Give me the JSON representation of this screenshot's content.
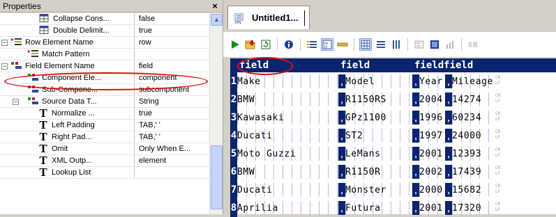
{
  "properties": {
    "title": "Properties",
    "close": "×",
    "rows": [
      {
        "label": "Collapse Cons...",
        "value": "false",
        "icon": "table-icon",
        "level": 2
      },
      {
        "label": "Double Delimit...",
        "value": "true",
        "icon": "table-icon",
        "level": 2
      },
      {
        "label": "Row Element Name",
        "value": "row",
        "icon": "list-element-icon",
        "level": 0
      },
      {
        "label": "Match Pattern",
        "value": "",
        "icon": "list-element-icon",
        "level": 1
      },
      {
        "label": "Field Element Name",
        "value": "field",
        "icon": "element-node-icon",
        "level": 0
      },
      {
        "label": "Component Ele...",
        "value": "component",
        "icon": "element-node-icon",
        "level": 1
      },
      {
        "label": "Sub-Compone...",
        "value": "subcomponent",
        "icon": "element-node-icon",
        "level": 1
      },
      {
        "label": "Source Data T...",
        "value": "String",
        "icon": "element-node-icon",
        "level": 1
      },
      {
        "label": "Normalize ...",
        "value": "true",
        "icon": "text-t-icon",
        "level": 2
      },
      {
        "label": "Left Padding",
        "value": "TAB,' '",
        "icon": "text-t-icon",
        "level": 2
      },
      {
        "label": "Right Pad...",
        "value": "TAB,' '",
        "icon": "text-t-icon",
        "level": 2
      },
      {
        "label": "Omit",
        "value": "Only When E...",
        "icon": "text-t-icon",
        "level": 2
      },
      {
        "label": "XML Outp...",
        "value": "element",
        "icon": "text-t-icon",
        "level": 2
      },
      {
        "label": "Lookup List",
        "value": "",
        "icon": "text-t-icon",
        "level": 2
      }
    ]
  },
  "document": {
    "tab_label": "Untitled1...",
    "headers": [
      "field",
      "field",
      "fieldfield"
    ],
    "rows": [
      {
        "n": "1",
        "cells": [
          "Make",
          "Model",
          "Year",
          "Mileage"
        ]
      },
      {
        "n": "2",
        "cells": [
          "BMW",
          "R1150RS",
          "2004",
          "14274"
        ]
      },
      {
        "n": "3",
        "cells": [
          "Kawasaki",
          "GPz1100",
          "1996",
          "60234"
        ]
      },
      {
        "n": "4",
        "cells": [
          "Ducati",
          "ST2",
          "1997",
          "24000"
        ]
      },
      {
        "n": "5",
        "cells": [
          "Moto Guzzi",
          "LeMans",
          "2001",
          "12393"
        ]
      },
      {
        "n": "6",
        "cells": [
          "BMW",
          "R1150R",
          "2002",
          "17439"
        ]
      },
      {
        "n": "7",
        "cells": [
          "Ducati",
          "Monster",
          "2000",
          "15682"
        ]
      },
      {
        "n": "8",
        "cells": [
          "Aprilia",
          "Futura",
          "2001",
          "17320"
        ]
      }
    ],
    "sep_char": ",",
    "eol_glyph": "CR LF"
  },
  "colors": {
    "accent": "#0a2470",
    "highlight_oval": "#e01010",
    "tab_bg": "#ffffff"
  }
}
